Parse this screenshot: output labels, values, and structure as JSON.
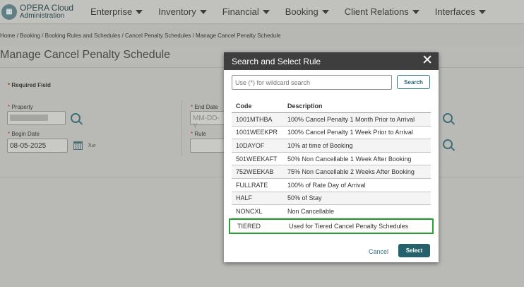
{
  "brand": {
    "line1": "OPERA Cloud",
    "line2": "Administration"
  },
  "nav": [
    "Enterprise",
    "Inventory",
    "Financial",
    "Booking",
    "Client Relations",
    "Interfaces"
  ],
  "breadcrumb": "Home / Booking / Booking Rules and Schedules / Cancel Penalty Schedules / Manage Cancel Penalty Schedule",
  "page_title": "Manage Cancel Penalty Schedule",
  "form": {
    "required_label": "Required Field",
    "property_label": "Property",
    "begin_date_label": "Begin Date",
    "begin_date_value": "08-05-2025",
    "begin_date_day": "Tue",
    "end_date_label": "End Date",
    "end_date_placeholder": "MM-DD-Y",
    "rule_label": "Rule"
  },
  "dialog": {
    "title": "Search and Select Rule",
    "search_placeholder": "Use (*) for wildcard search",
    "search_button": "Search",
    "columns": {
      "code": "Code",
      "description": "Description"
    },
    "rows": [
      {
        "code": "1001MTHBA",
        "description": "100% Cancel Penalty 1 Month Prior to Arrival"
      },
      {
        "code": "1001WEEKPR",
        "description": "100% Cancel Penalty 1 Week Prior to Arrival"
      },
      {
        "code": "10DAYOF",
        "description": "10% at time of Booking"
      },
      {
        "code": "501WEEKAFT",
        "description": "50% Non Cancellable 1 Week After Booking"
      },
      {
        "code": "752WEEKAB",
        "description": "75% Non Cancellable 2 Weeks After Booking"
      },
      {
        "code": "FULLRATE",
        "description": "100% of Rate Day of Arrival"
      },
      {
        "code": "HALF",
        "description": "50% of Stay"
      },
      {
        "code": "NONCXL",
        "description": "Non Cancellable"
      },
      {
        "code": "TIERED",
        "description": "Used for Tiered Cancel Penalty Schedules"
      }
    ],
    "cancel_label": "Cancel",
    "select_label": "Select"
  }
}
